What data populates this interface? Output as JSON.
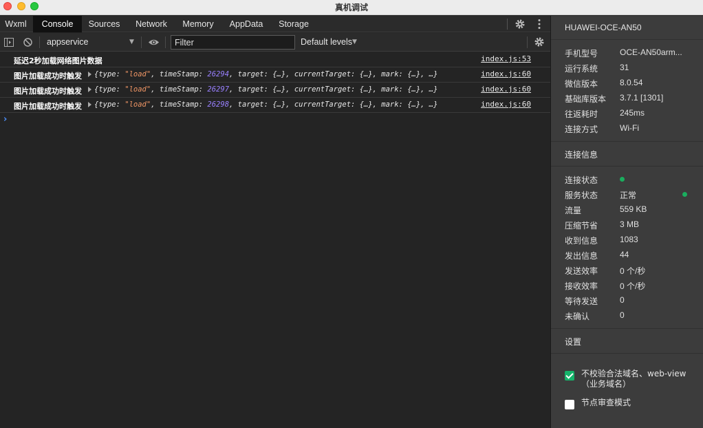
{
  "window": {
    "title": "真机调试"
  },
  "tabs": [
    {
      "label": "Wxml"
    },
    {
      "label": "Console",
      "active": true
    },
    {
      "label": "Sources"
    },
    {
      "label": "Network"
    },
    {
      "label": "Memory"
    },
    {
      "label": "AppData"
    },
    {
      "label": "Storage"
    }
  ],
  "toolbar": {
    "context": "appservice",
    "filter_placeholder": "Filter",
    "levels": "Default levels"
  },
  "console": {
    "rows": [
      {
        "message": "延迟2秒加载网络图片数据",
        "source": "index.js:53",
        "expandable": false
      },
      {
        "message": "图片加载成功时触发",
        "source": "index.js:60",
        "expandable": true,
        "object": {
          "type": "load",
          "timeStamp": 26294
        }
      },
      {
        "message": "图片加载成功时触发",
        "source": "index.js:60",
        "expandable": true,
        "object": {
          "type": "load",
          "timeStamp": 26297
        }
      },
      {
        "message": "图片加载成功时触发",
        "source": "index.js:60",
        "expandable": true,
        "object": {
          "type": "load",
          "timeStamp": 26298
        }
      }
    ],
    "prompt": "›"
  },
  "panel": {
    "device": "HUAWEI-OCE-AN50",
    "device_info": [
      {
        "key": "手机型号",
        "value": "OCE-AN50arm..."
      },
      {
        "key": "运行系统",
        "value": "31"
      },
      {
        "key": "微信版本",
        "value": "8.0.54"
      },
      {
        "key": "基础库版本",
        "value": "3.7.1 [1301]"
      },
      {
        "key": "往返耗时",
        "value": "245ms"
      },
      {
        "key": "连接方式",
        "value": "Wi-Fi"
      }
    ],
    "connection_title": "连接信息",
    "connection_info": [
      {
        "key": "连接状态",
        "value": "",
        "dot": true
      },
      {
        "key": "服务状态",
        "value": "正常",
        "dot_right": true
      },
      {
        "key": "流量",
        "value": "559 KB"
      },
      {
        "key": "压缩节省",
        "value": "3 MB"
      },
      {
        "key": "收到信息",
        "value": "1083"
      },
      {
        "key": "发出信息",
        "value": "44"
      },
      {
        "key": "发送效率",
        "value": "0 个/秒"
      },
      {
        "key": "接收效率",
        "value": "0 个/秒"
      },
      {
        "key": "等待发送",
        "value": "0"
      },
      {
        "key": "未确认",
        "value": "0"
      }
    ],
    "settings_title": "设置",
    "settings": [
      {
        "label": "不校验合法域名、web-view（业务域名）",
        "checked": true
      },
      {
        "label": "节点审查模式",
        "checked": false
      }
    ]
  },
  "colors": {
    "status_green": "#1aad5e",
    "checkbox_green": "#15b36a",
    "string": "#f29766",
    "number": "#9980ff"
  }
}
